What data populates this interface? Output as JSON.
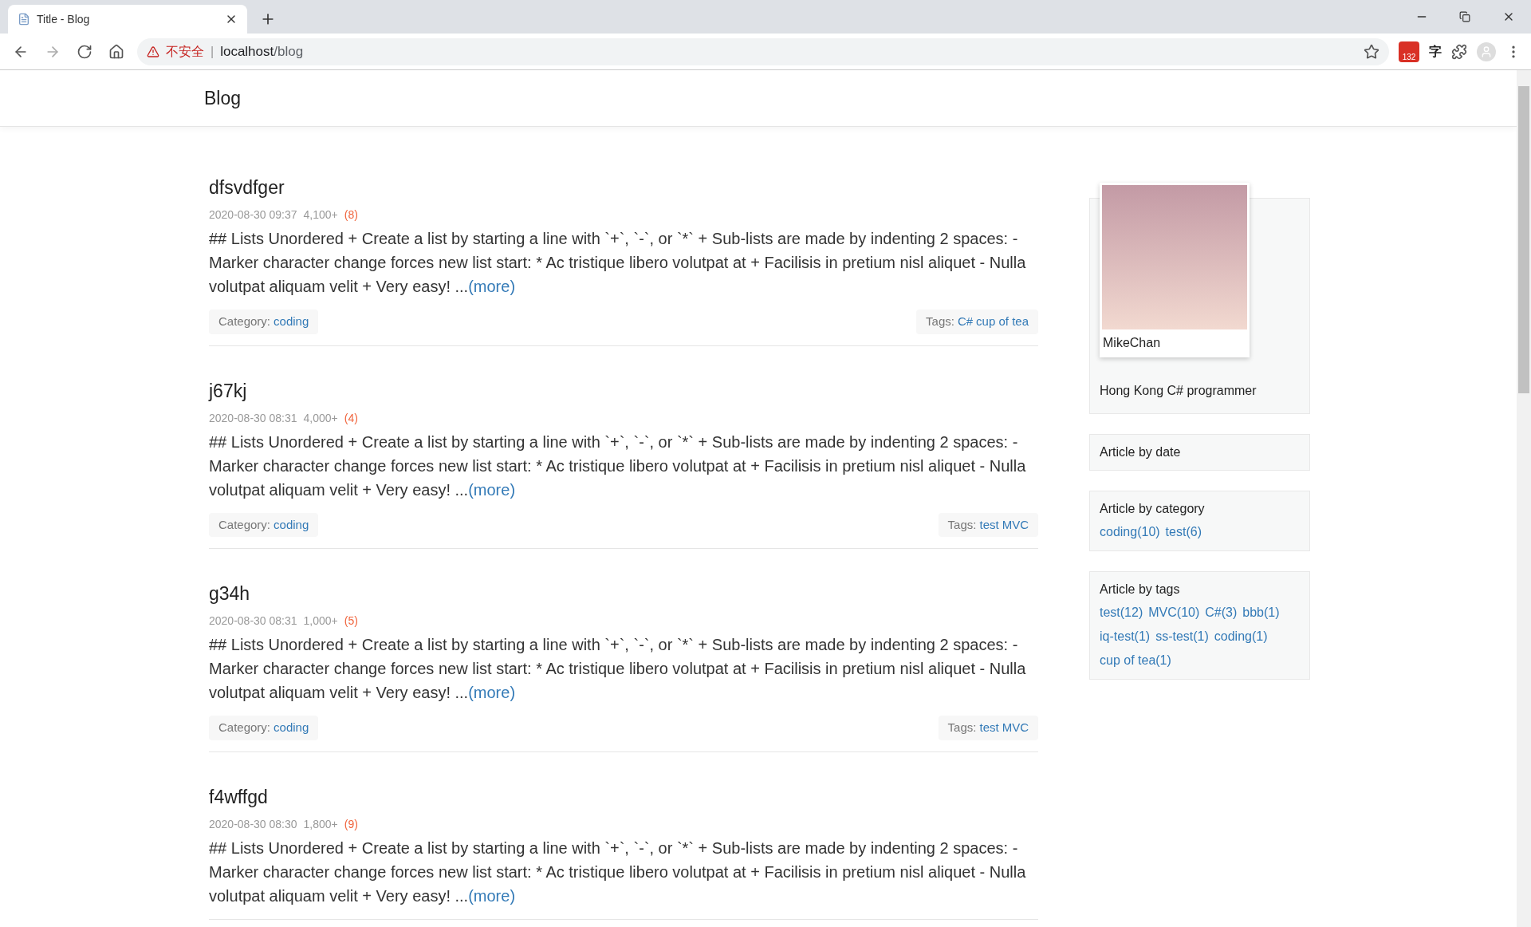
{
  "browser": {
    "tab_title": "Title - Blog",
    "security_label": "不安全",
    "separator": "|",
    "url_host": "localhost",
    "url_path": "/blog",
    "mail_badge": "132",
    "translate_label": "字"
  },
  "nav": {
    "brand": "Blog"
  },
  "posts": [
    {
      "title": "dfsvdfger",
      "date": "2020-08-30 09:37",
      "views": "4,100+",
      "comments": "(8)",
      "excerpt": "## Lists Unordered + Create a list by starting a line with `+`, `-`, or `*` + Sub-lists are made by indenting 2 spaces: - Marker character change forces new list start: * Ac tristique libero volutpat at + Facilisis in pretium nisl aliquet - Nulla volutpat aliquam velit + Very easy! ...",
      "more": "(more)",
      "category_label": "Category:",
      "category": "coding",
      "tags_label": "Tags:",
      "tags": [
        "C#",
        "cup of tea"
      ]
    },
    {
      "title": "j67kj",
      "date": "2020-08-30 08:31",
      "views": "4,000+",
      "comments": "(4)",
      "excerpt": "## Lists Unordered + Create a list by starting a line with `+`, `-`, or `*` + Sub-lists are made by indenting 2 spaces: - Marker character change forces new list start: * Ac tristique libero volutpat at + Facilisis in pretium nisl aliquet - Nulla volutpat aliquam velit + Very easy! ...",
      "more": "(more)",
      "category_label": "Category:",
      "category": "coding",
      "tags_label": "Tags:",
      "tags": [
        "test",
        "MVC"
      ]
    },
    {
      "title": "g34h",
      "date": "2020-08-30 08:31",
      "views": "1,000+",
      "comments": "(5)",
      "excerpt": "## Lists Unordered + Create a list by starting a line with `+`, `-`, or `*` + Sub-lists are made by indenting 2 spaces: - Marker character change forces new list start: * Ac tristique libero volutpat at + Facilisis in pretium nisl aliquet - Nulla volutpat aliquam velit + Very easy! ...",
      "more": "(more)",
      "category_label": "Category:",
      "category": "coding",
      "tags_label": "Tags:",
      "tags": [
        "test",
        "MVC"
      ]
    },
    {
      "title": "f4wffgd",
      "date": "2020-08-30 08:30",
      "views": "1,800+",
      "comments": "(9)",
      "excerpt": "## Lists Unordered + Create a list by starting a line with `+`, `-`, or `*` + Sub-lists are made by indenting 2 spaces: - Marker character change forces new list start: * Ac tristique libero volutpat at + Facilisis in pretium nisl aliquet - Nulla volutpat aliquam velit + Very easy! ...",
      "more": "(more)"
    }
  ],
  "sidebar": {
    "profile": {
      "name": "MikeChan",
      "bio": "Hong Kong C# programmer"
    },
    "sections": [
      {
        "title": "Article by date"
      },
      {
        "title": "Article by category",
        "links": [
          "coding(10)",
          "test(6)"
        ]
      },
      {
        "title": "Article by tags",
        "links": [
          "test(12)",
          "MVC(10)",
          "C#(3)",
          "bbb(1)",
          "iq-test(1)",
          "ss-test(1)",
          "coding(1)",
          "cup of tea(1)"
        ]
      }
    ]
  }
}
